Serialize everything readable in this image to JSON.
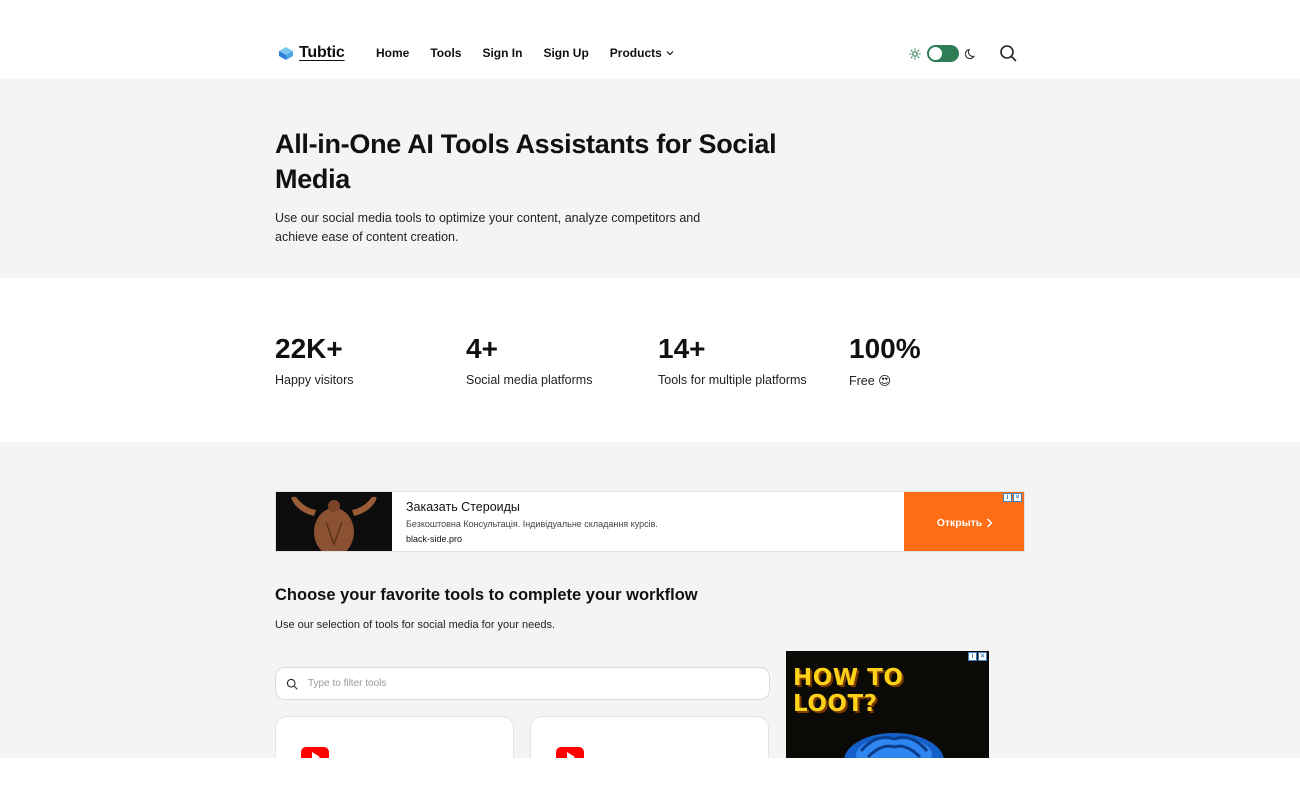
{
  "header": {
    "logo_text": "Tubtic",
    "nav": [
      "Home",
      "Tools",
      "Sign In",
      "Sign Up",
      "Products"
    ]
  },
  "hero": {
    "title": "All-in-One AI Tools Assistants for Social Media",
    "subtitle": "Use our social media tools to optimize your content, analyze competitors and achieve ease of content creation."
  },
  "stats": [
    {
      "value": "22K+",
      "label": "Happy visitors"
    },
    {
      "value": "4+",
      "label": "Social media platforms"
    },
    {
      "value": "14+",
      "label": "Tools for multiple platforms"
    },
    {
      "value": "100%",
      "label": "Free 😍"
    }
  ],
  "ad_banner": {
    "title": "Заказать Стероиды",
    "subtitle": "Безкоштовна Консультація. Індивідуальне складання курсів.",
    "url": "black-side.pro",
    "cta": "Открыть",
    "cta_color": "#ff6d14"
  },
  "tools_section": {
    "title": "Choose your favorite tools to complete your workflow",
    "subtitle": "Use our selection of tools for social media for your needs.",
    "filter_placeholder": "Type to filter tools"
  },
  "side_ad": {
    "headline": "HOW TO LOOT?"
  },
  "colors": {
    "toggle": "#2f7d57",
    "youtube": "#ff0000",
    "section_bg": "#f4f4f4"
  },
  "icons": [
    "logo-icon",
    "sun-icon",
    "moon-icon",
    "search-icon",
    "chevron-down-icon",
    "chevron-right-icon",
    "youtube-icon",
    "ad-info-icon",
    "ad-close-icon"
  ]
}
